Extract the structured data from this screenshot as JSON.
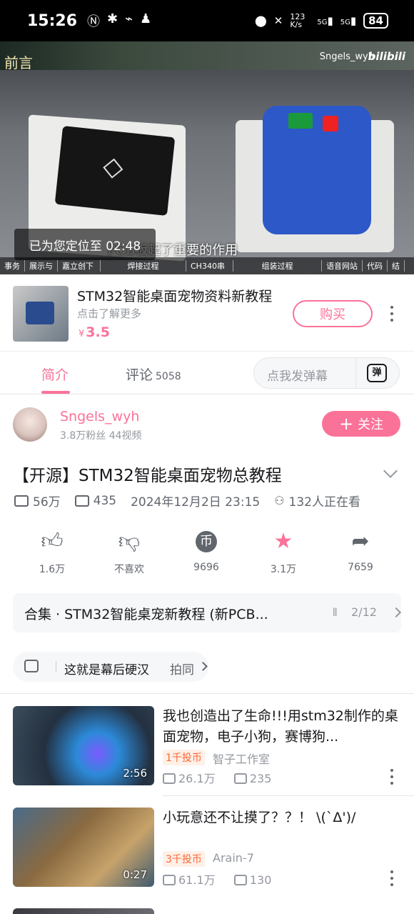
{
  "status_bar": {
    "time": "15:26",
    "network_speed": "123 K/s",
    "signal1": "5G",
    "signal2": "5G",
    "battery": "84"
  },
  "video_player": {
    "corner_text": "前言",
    "uploader_watermark": "Sngels_wyh",
    "platform_logo": "bilibili",
    "subtitle": "PCB板起了重要的作用",
    "toast": "已为您定位至 02:48",
    "chapters": [
      "事务",
      "展示与",
      "嘉立创下",
      "焊接过程",
      "CH340串",
      "组装过程",
      "语音网站",
      "代码",
      "结"
    ]
  },
  "product": {
    "title": "STM32智能桌面宠物资料新教程",
    "subtitle": "点击了解更多",
    "currency": "¥",
    "price": "3.5",
    "buy_label": "购买"
  },
  "tabs": {
    "intro": "简介",
    "comments": "评论",
    "comments_count": "5058",
    "danmu_placeholder": "点我发弹幕",
    "danmu_icon_label": "弹"
  },
  "uploader": {
    "name": "Sngels_wyh",
    "stats": "3.8万粉丝   44视频",
    "follow_label": "关注"
  },
  "video_info": {
    "title": "【开源】STM32智能桌面宠物总教程",
    "views": "56万",
    "danmu_count": "435",
    "date": "2024年12月2日 23:15",
    "watching": "132人正在看"
  },
  "actions": {
    "like": "1.6万",
    "dislike": "不喜欢",
    "coin": "9696",
    "favorite": "3.1万",
    "share": "7659"
  },
  "collection": {
    "name": "合集 · STM32智能桌宠新教程 (新PCB...",
    "progress": "2/12"
  },
  "tag_pill": {
    "text": "这就是幕后硬汉",
    "action": "拍同"
  },
  "recommended": [
    {
      "title": "我也创造出了生命!!!用stm32制作的桌面宠物，电子小狗，赛博狗...",
      "badge": "1千投币",
      "author": "智子工作室",
      "views": "26.1万",
      "danmu": "235",
      "duration": "2:56"
    },
    {
      "title": "小玩意还不让摸了？？！ \\(`Δ')/",
      "badge": "3千投币",
      "author": "Arain-7",
      "views": "61.1万",
      "danmu": "130",
      "duration": "0:27"
    }
  ],
  "colors": {
    "accent": "#fb7299",
    "text": "#18191c",
    "muted": "#9499a0"
  }
}
